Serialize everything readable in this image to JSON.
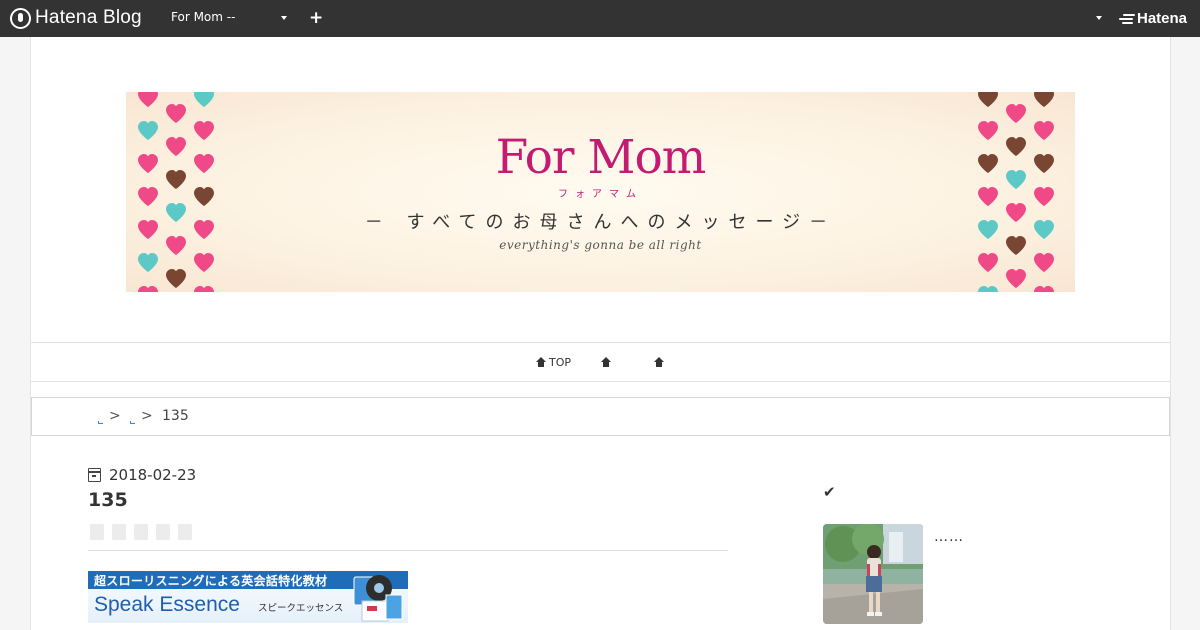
{
  "topbar": {
    "brand": "Hatena Blog",
    "blog_selector": "For Mom --",
    "add_label": "+",
    "hatena_label": "Hatena",
    "colors": {
      "bar": "#333333",
      "text": "#ffffff"
    }
  },
  "banner": {
    "title": "For Mom",
    "kana": "フォアマム",
    "tagline": "－ すべてのお母さんへのメッセージ－",
    "subtitle": "everything's gonna be all right",
    "colors": {
      "title": "#c21b71",
      "heart_pink": "#ef4a87",
      "heart_aqua": "#5cc9c6",
      "heart_brown": "#7a4634"
    }
  },
  "nav": {
    "items": [
      {
        "label": "TOP",
        "icon": "home-icon"
      },
      {
        "label": "",
        "icon": "home-icon"
      },
      {
        "label": "",
        "icon": "home-icon"
      }
    ]
  },
  "breadcrumb": {
    "separators": [
      ">",
      ">"
    ],
    "current": "135",
    "link_color": "#1a9ad6"
  },
  "article": {
    "date": "2018-02-23",
    "title": "135",
    "share_buttons": 5
  },
  "ad": {
    "headline": "超スローリスニングによる英会話特化教材",
    "brand": "Speak Essence",
    "brand_kana": "スピークエッセンス",
    "color": "#1f6cb8"
  },
  "sidebar": {
    "check_icon": "✔",
    "profile_text": "……"
  }
}
